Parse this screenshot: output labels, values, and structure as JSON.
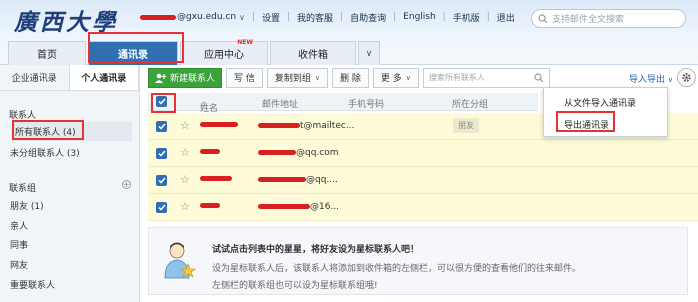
{
  "header": {
    "logo_text": "廣西大學",
    "email_suffix": "@gxu.edu.cn",
    "nav": [
      "设置",
      "我的客服",
      "自助查询",
      "English",
      "手机版",
      "退出"
    ],
    "search_placeholder": "支持邮件全文搜索"
  },
  "tabs": [
    {
      "label": "首页",
      "new": ""
    },
    {
      "label": "通讯录",
      "new": ""
    },
    {
      "label": "应用中心",
      "new": "NEW"
    },
    {
      "label": "收件箱",
      "new": ""
    }
  ],
  "sidebar": {
    "tab_enterprise": "企业通讯录",
    "tab_personal": "个人通讯录",
    "contacts_title": "联系人",
    "all_contacts": "所有联系人 (4)",
    "ungrouped": "未分组联系人 (3)",
    "groups_title": "联系组",
    "groups": [
      "朋友 (1)",
      "亲人",
      "同事",
      "网友",
      "重要联系人"
    ]
  },
  "toolbar": {
    "new_contact": "新建联系人",
    "write": "写 信",
    "copy_to": "复制到组",
    "delete": "删 除",
    "more": "更 多",
    "search_placeholder": "搜索所有联系人",
    "import_export": "导入导出"
  },
  "table": {
    "headers": {
      "name": "姓名",
      "name_sort": "↑",
      "email": "邮件地址",
      "phone": "手机号码",
      "group": "所在分组"
    },
    "rows": [
      {
        "email": "t@mailtec...",
        "group": "朋友"
      },
      {
        "email": "@qq.com",
        "group": ""
      },
      {
        "email": "@qq....",
        "group": ""
      },
      {
        "email": "@16...",
        "group": ""
      }
    ]
  },
  "dropdown": {
    "import": "从文件导入通讯录",
    "export": "导出通讯录"
  },
  "tip": {
    "title": "试试点击列表中的星星，将好友设为星标联系人吧！",
    "line1": "设为星标联系人后，该联系人将添加到收件箱的左侧栏，可以很方便的查看他们的往来邮件。",
    "line2": "左侧栏的联系组也可以设为星标联系组哦!"
  }
}
